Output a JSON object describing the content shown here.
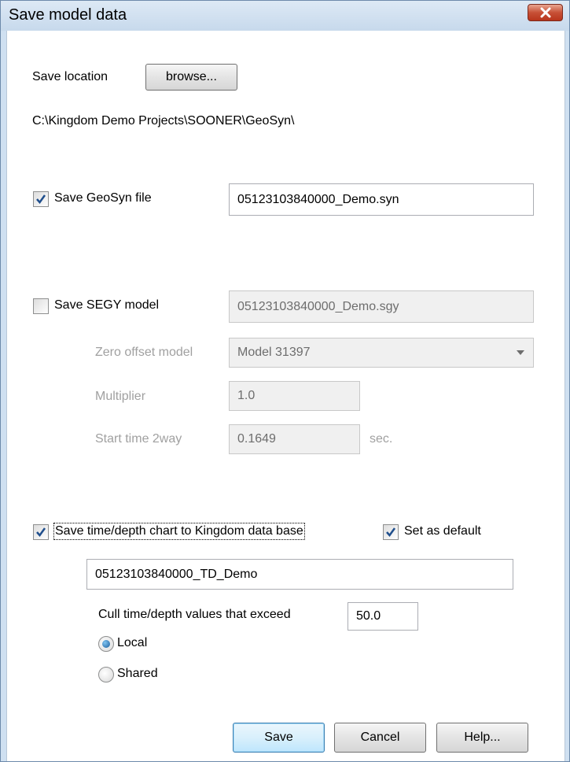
{
  "window": {
    "title": "Save model data"
  },
  "save_location": {
    "label": "Save location",
    "browse_label": "browse...",
    "path": "C:\\Kingdom Demo Projects\\SOONER\\GeoSyn\\"
  },
  "geosyn": {
    "checked": true,
    "label": "Save GeoSyn file",
    "filename": "05123103840000_Demo.syn"
  },
  "segy": {
    "checked": false,
    "label": "Save SEGY model",
    "filename": "05123103840000_Demo.sgy",
    "zero_offset_label": "Zero offset model",
    "zero_offset_value": "Model 31397",
    "multiplier_label": "Multiplier",
    "multiplier_value": "1.0",
    "start_time_label": "Start time 2way",
    "start_time_value": "0.1649",
    "start_time_unit": "sec."
  },
  "td_chart": {
    "checked": true,
    "label": "Save time/depth chart to Kingdom data base",
    "set_default_checked": true,
    "set_default_label": "Set as  default",
    "name": "05123103840000_TD_Demo",
    "cull_label": "Cull time/depth values that exceed",
    "cull_value": "50.0",
    "scope_options": [
      {
        "label": "Local",
        "selected": true
      },
      {
        "label": "Shared",
        "selected": false
      }
    ]
  },
  "buttons": {
    "save": "Save",
    "cancel": "Cancel",
    "help": "Help..."
  },
  "colors": {
    "accent_check": "#1f4e8c",
    "close_button": "#c75036",
    "disabled_text": "#a0a0a0"
  }
}
